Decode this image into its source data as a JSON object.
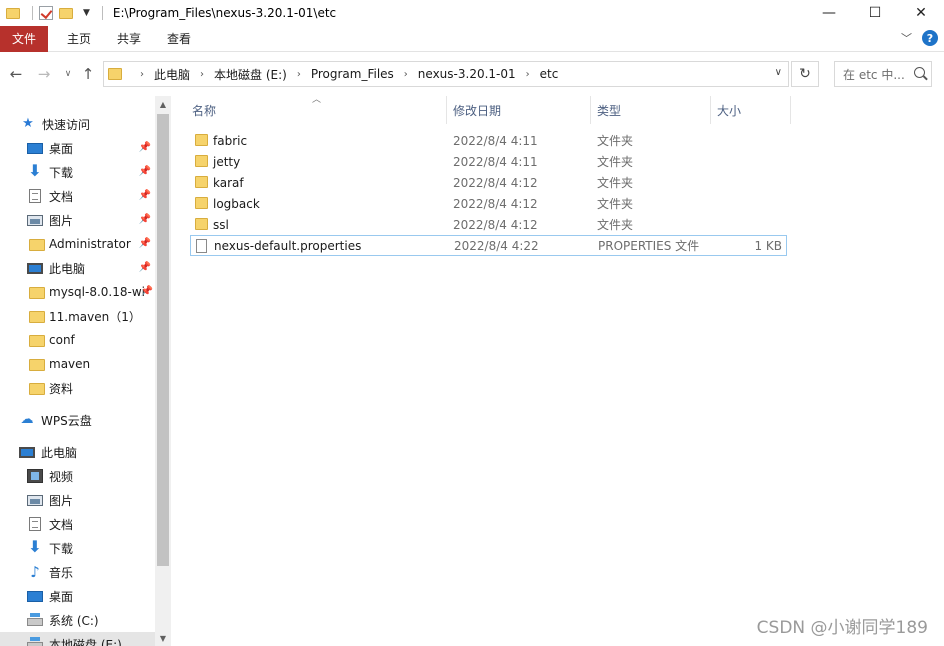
{
  "titlebar": {
    "path": "E:\\Program_Files\\nexus-3.20.1-01\\etc",
    "minimize": "—",
    "maximize": "☐",
    "close": "✕"
  },
  "ribbon": {
    "tabs": [
      "文件",
      "主页",
      "共享",
      "查看"
    ]
  },
  "address": {
    "crumbs": [
      "此电脑",
      "本地磁盘 (E:)",
      "Program_Files",
      "nexus-3.20.1-01",
      "etc"
    ],
    "search_placeholder": "在 etc 中..."
  },
  "sidebar": {
    "quick_access": "快速访问",
    "quick_items": [
      "桌面",
      "下载",
      "文档",
      "图片",
      "Administrator",
      "此电脑",
      "mysql-8.0.18-wi",
      "11.maven（1）",
      "conf",
      "maven",
      "资料"
    ],
    "wps": "WPS云盘",
    "this_pc": "此电脑",
    "pc_items": [
      "视频",
      "图片",
      "文档",
      "下载",
      "音乐",
      "桌面",
      "系统 (C:)",
      "本地磁盘 (E:)"
    ]
  },
  "columns": {
    "name": "名称",
    "date": "修改日期",
    "type": "类型",
    "size": "大小"
  },
  "files": [
    {
      "name": "fabric",
      "date": "2022/8/4 4:11",
      "type": "文件夹",
      "size": "",
      "kind": "folder"
    },
    {
      "name": "jetty",
      "date": "2022/8/4 4:11",
      "type": "文件夹",
      "size": "",
      "kind": "folder"
    },
    {
      "name": "karaf",
      "date": "2022/8/4 4:12",
      "type": "文件夹",
      "size": "",
      "kind": "folder"
    },
    {
      "name": "logback",
      "date": "2022/8/4 4:12",
      "type": "文件夹",
      "size": "",
      "kind": "folder"
    },
    {
      "name": "ssl",
      "date": "2022/8/4 4:12",
      "type": "文件夹",
      "size": "",
      "kind": "folder"
    },
    {
      "name": "nexus-default.properties",
      "date": "2022/8/4 4:22",
      "type": "PROPERTIES 文件",
      "size": "1 KB",
      "kind": "file"
    }
  ],
  "watermark": "CSDN @小谢同学189"
}
